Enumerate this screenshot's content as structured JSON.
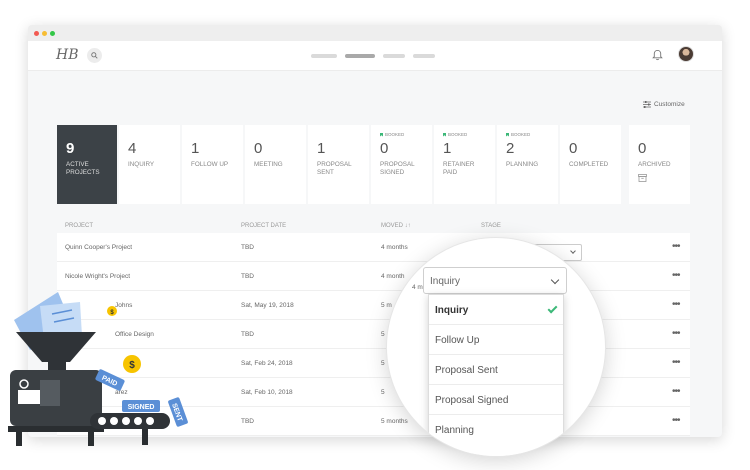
{
  "app": {
    "logo": "HB",
    "customize_label": "Customize"
  },
  "colors": {
    "accent": "#3cb878",
    "dark_tile": "#3c4247",
    "coin": "#f7c400",
    "ticket": "#5b8fd6"
  },
  "stats": [
    {
      "value": "9",
      "label": "ACTIVE PROJECTS",
      "booked": ""
    },
    {
      "value": "4",
      "label": "INQUIRY",
      "booked": ""
    },
    {
      "value": "1",
      "label": "FOLLOW UP",
      "booked": ""
    },
    {
      "value": "0",
      "label": "MEETING",
      "booked": ""
    },
    {
      "value": "1",
      "label": "PROPOSAL SENT",
      "booked": ""
    },
    {
      "value": "0",
      "label": "PROPOSAL SIGNED",
      "booked": "BOOKED"
    },
    {
      "value": "1",
      "label": "RETAINER PAID",
      "booked": "BOOKED"
    },
    {
      "value": "2",
      "label": "PLANNING",
      "booked": "BOOKED"
    },
    {
      "value": "0",
      "label": "COMPLETED",
      "booked": ""
    },
    {
      "value": "0",
      "label": "ARCHIVED",
      "booked": ""
    }
  ],
  "table": {
    "headers": {
      "project": "PROJECT",
      "date": "PROJECT DATE",
      "moved": "MOVED ↓↑",
      "stage": "STAGE"
    },
    "rows": [
      {
        "project": "Quinn Cooper's Project",
        "date": "TBD",
        "moved": "4 months"
      },
      {
        "project": "Nicole Wright's Project",
        "date": "TBD",
        "moved": "4 month"
      },
      {
        "project": "Johns",
        "date": "Sat, May 19, 2018",
        "moved": "5 m"
      },
      {
        "project": "Office Design",
        "date": "TBD",
        "moved": "5"
      },
      {
        "project": "",
        "date": "Sat, Feb 24, 2018",
        "moved": "5"
      },
      {
        "project": "arez",
        "date": "Sat, Feb 10, 2018",
        "moved": "5"
      },
      {
        "project": "",
        "date": "TBD",
        "moved": "5 months"
      }
    ]
  },
  "stage_dropdown": {
    "selected": "Inquiry",
    "options": [
      "Inquiry",
      "Follow Up",
      "Proposal Sent",
      "Proposal Signed",
      "Planning"
    ]
  },
  "illustration": {
    "tag_paid": "PAID",
    "tag_signed": "SIGNED",
    "tag_sent": "SENT",
    "coin_symbol": "$"
  }
}
